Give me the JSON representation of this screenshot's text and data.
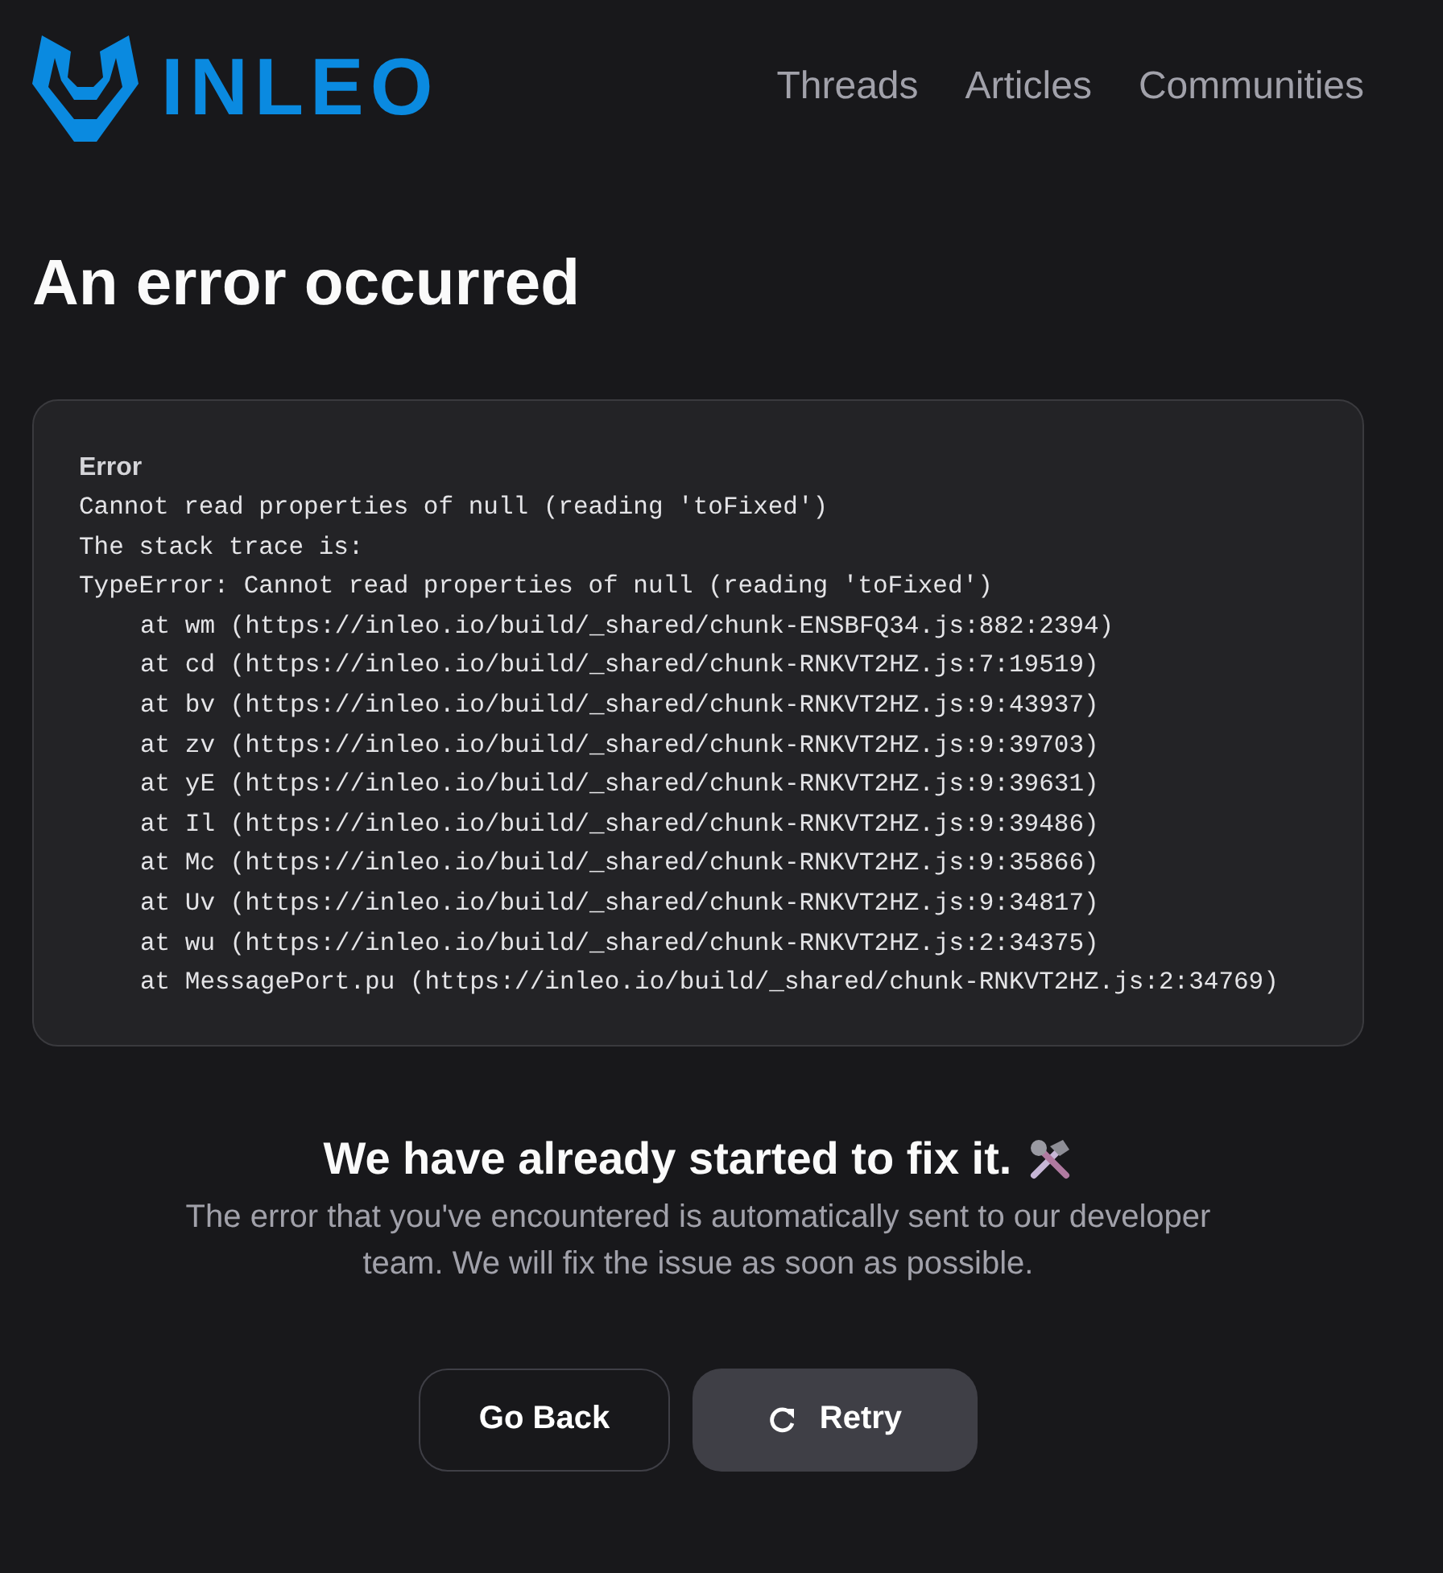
{
  "header": {
    "brand": "INLEO",
    "nav": [
      {
        "label": "Threads"
      },
      {
        "label": "Articles"
      },
      {
        "label": "Communities"
      }
    ]
  },
  "title": "An error occurred",
  "error_box": {
    "label": "Error",
    "message": "Cannot read properties of null (reading 'toFixed')",
    "trace_intro": "The stack trace is:",
    "trace_head": "TypeError: Cannot read properties of null (reading 'toFixed')",
    "frames": [
      "at wm (https://inleo.io/build/_shared/chunk-ENSBFQ34.js:882:2394)",
      "at cd (https://inleo.io/build/_shared/chunk-RNKVT2HZ.js:7:19519)",
      "at bv (https://inleo.io/build/_shared/chunk-RNKVT2HZ.js:9:43937)",
      "at zv (https://inleo.io/build/_shared/chunk-RNKVT2HZ.js:9:39703)",
      "at yE (https://inleo.io/build/_shared/chunk-RNKVT2HZ.js:9:39631)",
      "at Il (https://inleo.io/build/_shared/chunk-RNKVT2HZ.js:9:39486)",
      "at Mc (https://inleo.io/build/_shared/chunk-RNKVT2HZ.js:9:35866)",
      "at Uv (https://inleo.io/build/_shared/chunk-RNKVT2HZ.js:9:34817)",
      "at wu (https://inleo.io/build/_shared/chunk-RNKVT2HZ.js:2:34375)",
      "at MessagePort.pu (https://inleo.io/build/_shared/chunk-RNKVT2HZ.js:2:34769)"
    ]
  },
  "notice": {
    "heading": "We have already started to fix it.",
    "text": "The error that you've encountered is automatically sent to our developer team. We will fix the issue as soon as possible."
  },
  "buttons": [
    {
      "label": "Go Back",
      "kind": "outline"
    },
    {
      "label": "Retry",
      "kind": "retry"
    }
  ]
}
